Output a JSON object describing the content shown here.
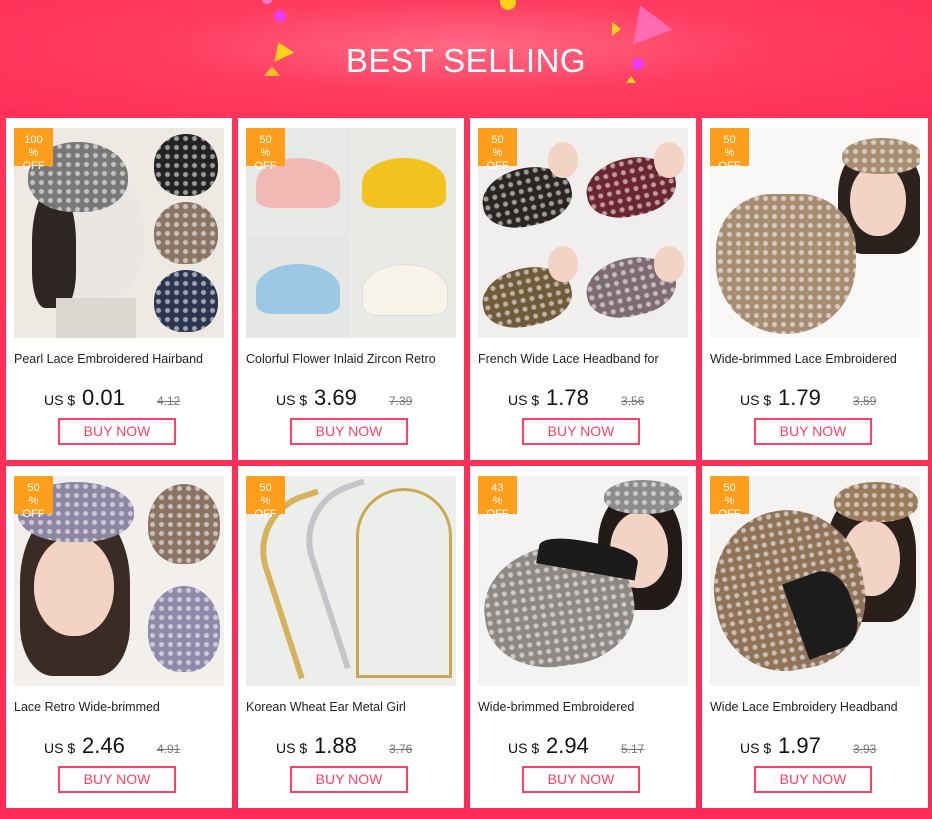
{
  "banner": {
    "title": "BEST SELLING"
  },
  "colors": {
    "accent": "#ff4067",
    "badge": "#ff9e1b",
    "background": "#ff2d57"
  },
  "products": [
    {
      "discount_pct": "100",
      "discount_sign": "%",
      "discount_word": "OFF",
      "name": "Pearl Lace Embroidered Hairband",
      "currency": "US $",
      "price": "0.01",
      "old_price": "4.12",
      "buy_label": "BUY NOW"
    },
    {
      "discount_pct": "50",
      "discount_sign": "%",
      "discount_word": "OFF",
      "name": "Colorful Flower Inlaid Zircon Retro",
      "currency": "US $",
      "price": "3.69",
      "old_price": "7.39",
      "buy_label": "BUY NOW"
    },
    {
      "discount_pct": "50",
      "discount_sign": "%",
      "discount_word": "OFF",
      "name": "French Wide Lace Headband for",
      "currency": "US $",
      "price": "1.78",
      "old_price": "3.56",
      "buy_label": "BUY NOW"
    },
    {
      "discount_pct": "50",
      "discount_sign": "%",
      "discount_word": "OFF",
      "name": "Wide-brimmed Lace Embroidered",
      "currency": "US $",
      "price": "1.79",
      "old_price": "3.59",
      "buy_label": "BUY NOW"
    },
    {
      "discount_pct": "50",
      "discount_sign": "%",
      "discount_word": "OFF",
      "name": "Lace Retro Wide-brimmed",
      "currency": "US $",
      "price": "2.46",
      "old_price": "4.91",
      "buy_label": "BUY NOW"
    },
    {
      "discount_pct": "50",
      "discount_sign": "%",
      "discount_word": "OFF",
      "name": "Korean Wheat Ear Metal Girl",
      "currency": "US $",
      "price": "1.88",
      "old_price": "3.76",
      "buy_label": "BUY NOW"
    },
    {
      "discount_pct": "43",
      "discount_sign": "%",
      "discount_word": "OFF",
      "name": "Wide-brimmed Embroidered",
      "currency": "US $",
      "price": "2.94",
      "old_price": "5.17",
      "buy_label": "BUY NOW"
    },
    {
      "discount_pct": "50",
      "discount_sign": "%",
      "discount_word": "OFF",
      "name": "Wide Lace Embroidery Headband",
      "currency": "US $",
      "price": "1.97",
      "old_price": "3.93",
      "buy_label": "BUY NOW"
    }
  ]
}
